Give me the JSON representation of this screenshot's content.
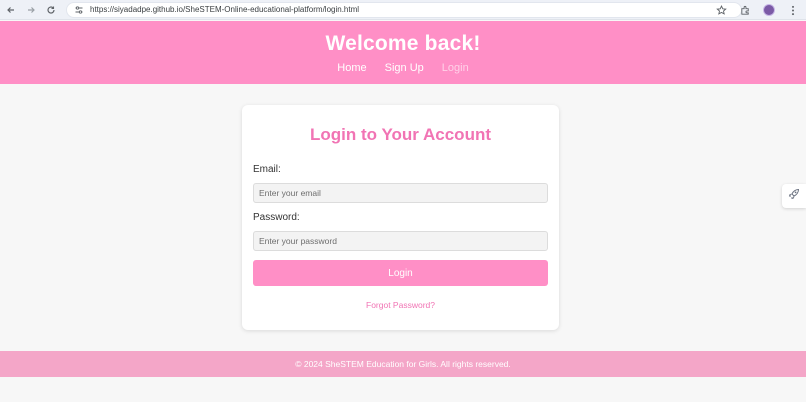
{
  "browser": {
    "url": "https://siyadadpe.github.io/SheSTEM-Online-educational-platform/login.html",
    "icons": [
      "back-arrow-icon",
      "forward-arrow-icon",
      "reload-icon",
      "site-info-icon",
      "star-icon",
      "extensions-icon",
      "profile-avatar",
      "more-menu-icon"
    ]
  },
  "header": {
    "title": "Welcome back!",
    "nav": {
      "home": "Home",
      "signup": "Sign Up",
      "login": "Login"
    },
    "background_color": "#ff8fc6"
  },
  "login_card": {
    "title": "Login to Your Account",
    "email_label": "Email:",
    "email_placeholder": "Enter your email",
    "email_value": "",
    "password_label": "Password:",
    "password_placeholder": "Enter your password",
    "password_value": "",
    "submit_label": "Login",
    "forgot_link": "Forgot Password?",
    "accent_color": "#f174b4"
  },
  "side_widget": {
    "icon": "rocket-icon"
  },
  "footer": {
    "text": "© 2024 SheSTEM Education for Girls. All rights reserved.",
    "background_color": "#f4a6c8"
  }
}
